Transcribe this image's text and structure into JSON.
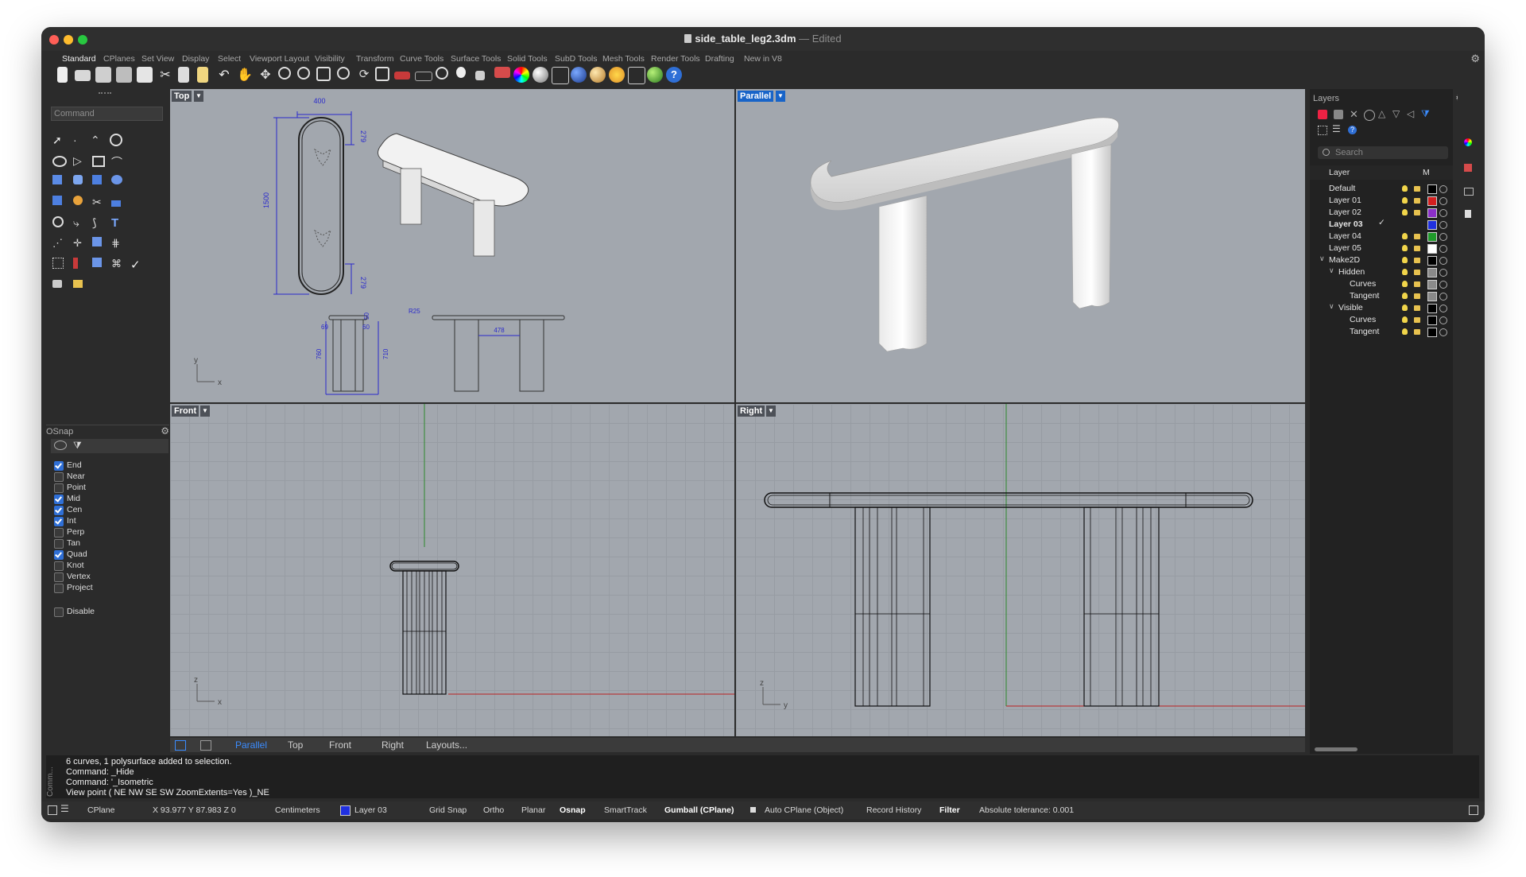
{
  "window": {
    "filename": "side_table_leg2.3dm",
    "separator": "—",
    "state": "Edited"
  },
  "tabs": [
    "Standard",
    "CPlanes",
    "Set View",
    "Display",
    "Select",
    "Viewport Layout",
    "Visibility",
    "Transform",
    "Curve Tools",
    "Surface Tools",
    "Solid Tools",
    "SubD Tools",
    "Mesh Tools",
    "Render Tools",
    "Drafting",
    "New in V8"
  ],
  "command": {
    "placeholder": "Command"
  },
  "osnap": {
    "title": "OSnap",
    "items": [
      {
        "label": "End",
        "checked": true
      },
      {
        "label": "Near",
        "checked": false
      },
      {
        "label": "Point",
        "checked": false
      },
      {
        "label": "Mid",
        "checked": true
      },
      {
        "label": "Cen",
        "checked": true
      },
      {
        "label": "Int",
        "checked": true
      },
      {
        "label": "Perp",
        "checked": false
      },
      {
        "label": "Tan",
        "checked": false
      },
      {
        "label": "Quad",
        "checked": true
      },
      {
        "label": "Knot",
        "checked": false
      },
      {
        "label": "Vertex",
        "checked": false
      },
      {
        "label": "Project",
        "checked": false
      }
    ],
    "disable": "Disable"
  },
  "viewports": {
    "top": {
      "label": "Top",
      "dims": {
        "w": "400",
        "r_top": "279",
        "len": "1500",
        "r_bot": "279",
        "h50": "50",
        "w60": "60",
        "w69": "69",
        "r25": "R25",
        "span": "478",
        "h760": "760",
        "h710": "710"
      },
      "axis_y": "y",
      "axis_x": "x"
    },
    "persp": {
      "label": "Parallel"
    },
    "front": {
      "label": "Front",
      "axis_z": "z",
      "axis_x": "x"
    },
    "right": {
      "label": "Right",
      "axis_z": "z",
      "axis_y": "y"
    }
  },
  "view_tabs": [
    "Parallel",
    "Top",
    "Front",
    "Right",
    "Layouts..."
  ],
  "layers": {
    "title": "Layers",
    "search": "Search",
    "col_layer": "Layer",
    "col_m": "M",
    "rows": [
      {
        "name": "Default",
        "color": "#000000",
        "bold": false,
        "indent": 0
      },
      {
        "name": "Layer 01",
        "color": "#d42020",
        "bold": false,
        "indent": 0
      },
      {
        "name": "Layer 02",
        "color": "#8b2fc9",
        "bold": false,
        "indent": 0
      },
      {
        "name": "Layer 03",
        "color": "#2030e0",
        "bold": true,
        "indent": 0
      },
      {
        "name": "Layer 04",
        "color": "#1f9a2a",
        "bold": false,
        "indent": 0
      },
      {
        "name": "Layer 05",
        "color": "#ffffff",
        "bold": false,
        "indent": 0
      },
      {
        "name": "Make2D",
        "color": "#000000",
        "bold": false,
        "indent": 0
      },
      {
        "name": "Hidden",
        "color": "#8a8a8a",
        "bold": false,
        "indent": 1
      },
      {
        "name": "Curves",
        "color": "#8a8a8a",
        "bold": false,
        "indent": 2
      },
      {
        "name": "Tangent",
        "color": "#8a8a8a",
        "bold": false,
        "indent": 2
      },
      {
        "name": "Visible",
        "color": "#000000",
        "bold": false,
        "indent": 1
      },
      {
        "name": "Curves",
        "color": "#000000",
        "bold": false,
        "indent": 2
      },
      {
        "name": "Tangent",
        "color": "#000000",
        "bold": false,
        "indent": 2
      }
    ]
  },
  "history": [
    "6 curves, 1 polysurface added to selection.",
    "Command: _Hide",
    "Command: '_Isometric",
    "View point ( NE NW SE SW ZoomExtents=Yes )_NE"
  ],
  "history_label": "Comm...",
  "status": {
    "cplane": "CPlane",
    "coords": "X 93.977 Y 87.983 Z 0",
    "units": "Centimeters",
    "layer": "Layer 03",
    "layer_color": "#2030e0",
    "grid_snap": "Grid Snap",
    "ortho": "Ortho",
    "planar": "Planar",
    "osnap": "Osnap",
    "smarttrack": "SmartTrack",
    "gumball": "Gumball (CPlane)",
    "auto_cplane": "Auto CPlane (Object)",
    "record_history": "Record History",
    "filter": "Filter",
    "tolerance": "Absolute tolerance: 0.001"
  }
}
